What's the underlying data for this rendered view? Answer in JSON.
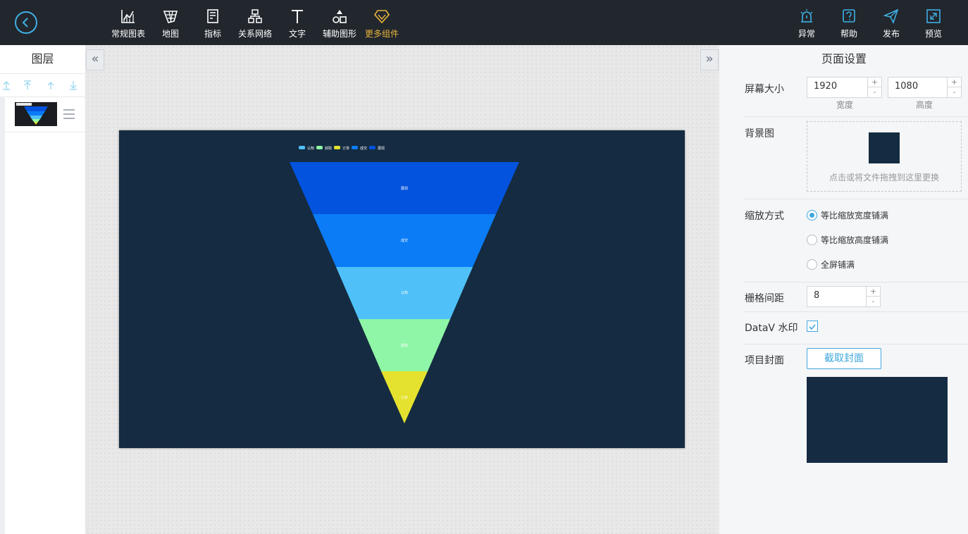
{
  "toolbar": {
    "items": [
      {
        "label": "常规图表",
        "icon": "chart-icon"
      },
      {
        "label": "地图",
        "icon": "map-icon"
      },
      {
        "label": "指标",
        "icon": "indicator-icon"
      },
      {
        "label": "关系网络",
        "icon": "network-icon"
      },
      {
        "label": "文字",
        "icon": "text-icon"
      },
      {
        "label": "辅助图形",
        "icon": "shapes-icon"
      },
      {
        "label": "更多组件",
        "icon": "diamond-icon"
      }
    ],
    "active_item": "更多组件",
    "right_items": [
      {
        "label": "异常",
        "icon": "alarm-icon"
      },
      {
        "label": "帮助",
        "icon": "help-icon"
      },
      {
        "label": "发布",
        "icon": "send-icon"
      },
      {
        "label": "预览",
        "icon": "preview-icon"
      }
    ]
  },
  "layers": {
    "title": "图层",
    "controls": [
      "move-top-icon",
      "move-up-top-icon",
      "move-up-icon",
      "move-down-icon"
    ]
  },
  "canvas": {
    "background": "#152b41",
    "legend": [
      "认知",
      "获取",
      "订单",
      "成交",
      "展现"
    ],
    "funnel": [
      {
        "label": "展现",
        "color": "#0353de"
      },
      {
        "label": "成交",
        "color": "#0b7cf6"
      },
      {
        "label": "认知",
        "color": "#4fc1f8"
      },
      {
        "label": "获取",
        "color": "#8ef6a6"
      },
      {
        "label": "订单",
        "color": "#e4e22e"
      }
    ]
  },
  "settings": {
    "title": "页面设置",
    "screen_size_label": "屏幕大小",
    "width": "1920",
    "height": "1080",
    "width_label": "宽度",
    "height_label": "高度",
    "background_label": "背景图",
    "dropzone_text": "点击或将文件拖拽到这里更换",
    "scale_label": "缩放方式",
    "scale_options": [
      "等比缩放宽度铺满",
      "等比缩放高度铺满",
      "全屏铺满"
    ],
    "scale_selected": 0,
    "grid_label": "栅格间距",
    "grid_value": "8",
    "watermark_label": "DataV 水印",
    "watermark_checked": true,
    "cover_label": "项目封面",
    "capture_button": "截取封面",
    "spin_plus": "+",
    "spin_minus": "-"
  },
  "colors": {
    "accent": "#3fa8dc",
    "active_tool": "#e8b43a",
    "toolbar_bg": "#22272e"
  }
}
